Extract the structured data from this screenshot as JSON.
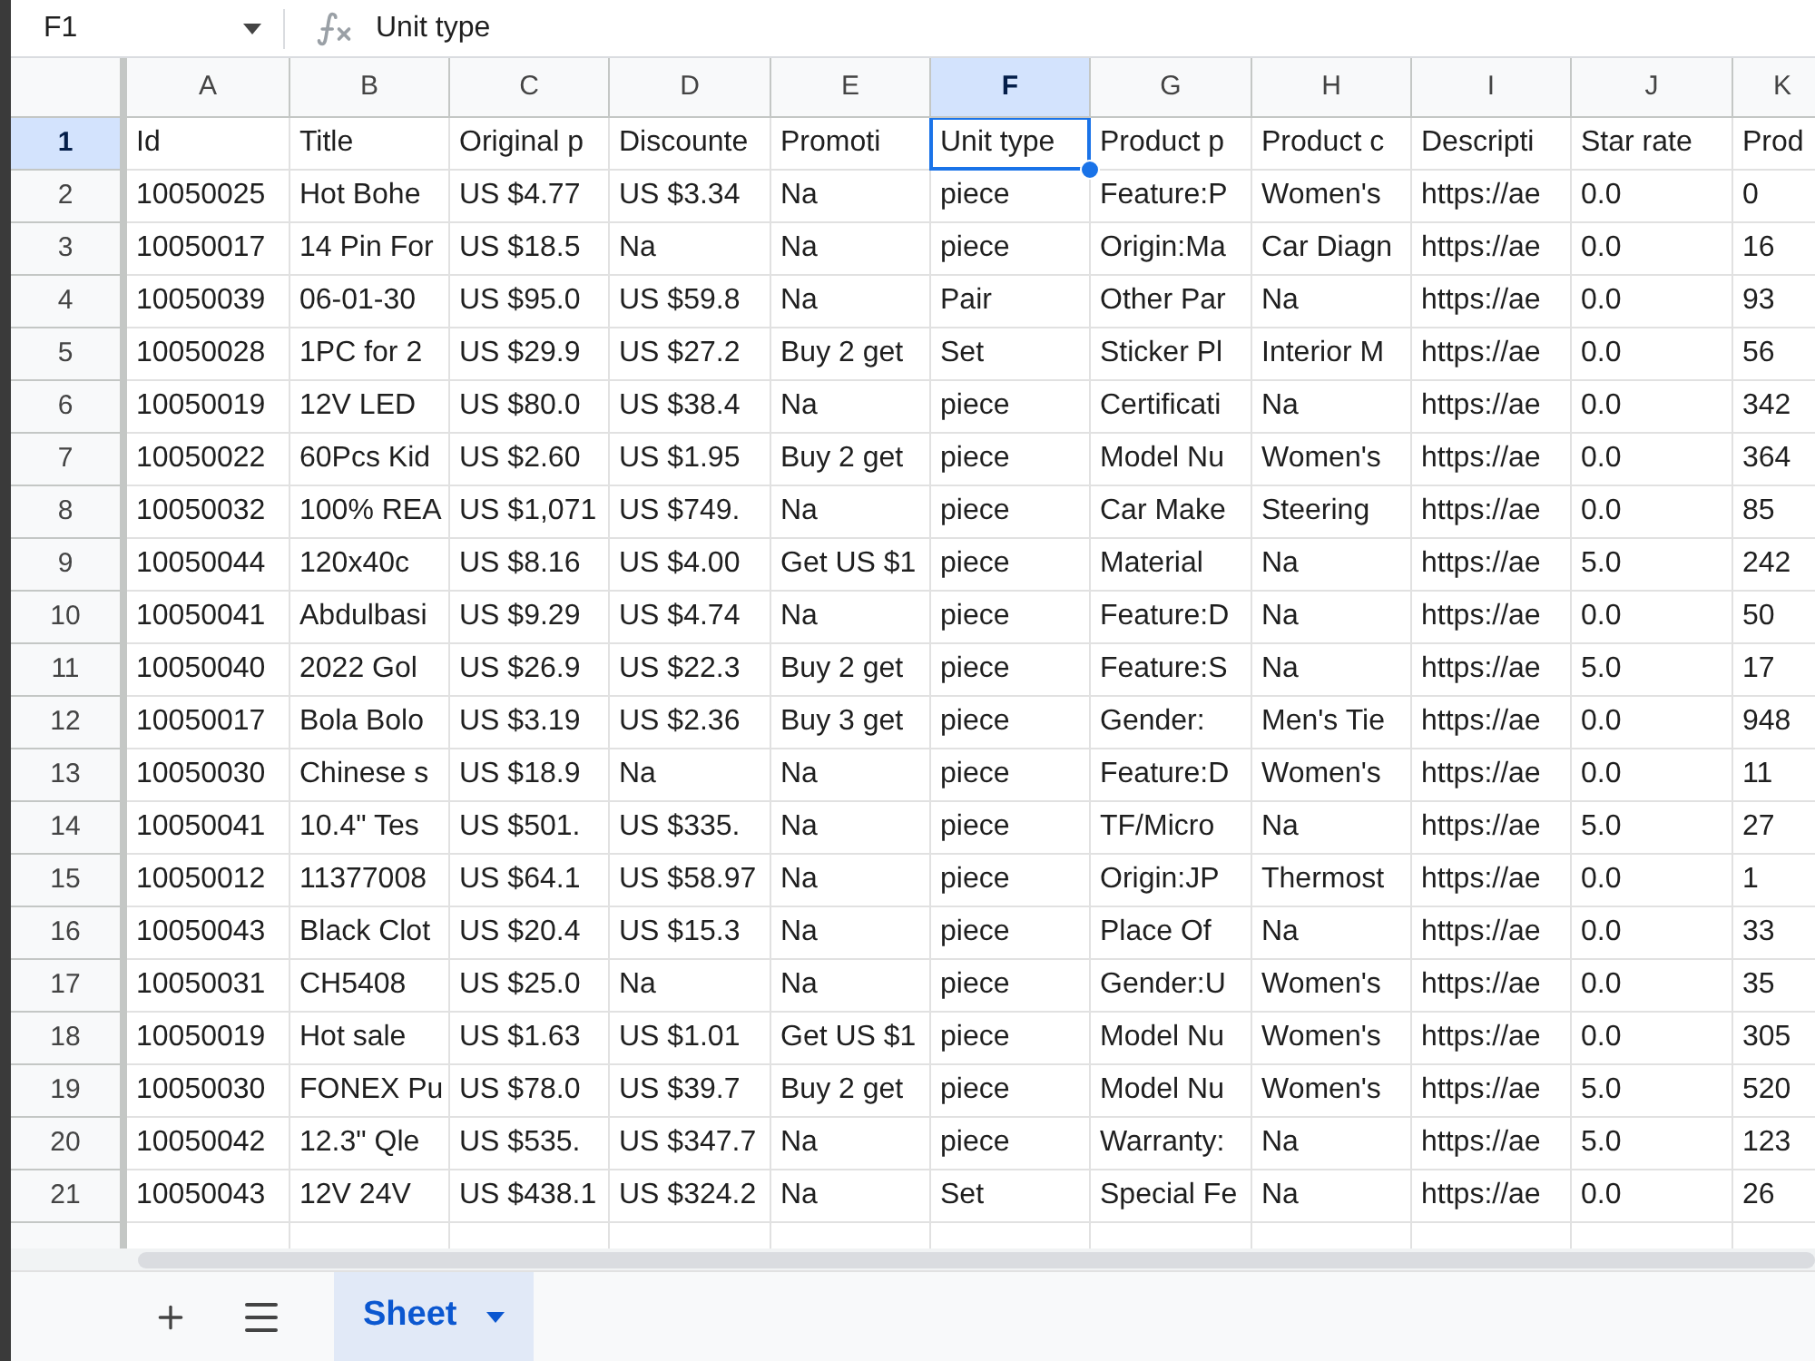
{
  "name_box": "F1",
  "formula_bar": {
    "value": "Unit type"
  },
  "columns": [
    {
      "label": "A",
      "selected": false
    },
    {
      "label": "B",
      "selected": false
    },
    {
      "label": "C",
      "selected": false
    },
    {
      "label": "D",
      "selected": false
    },
    {
      "label": "E",
      "selected": false
    },
    {
      "label": "F",
      "selected": true
    },
    {
      "label": "G",
      "selected": false
    },
    {
      "label": "H",
      "selected": false
    },
    {
      "label": "I",
      "selected": false
    },
    {
      "label": "J",
      "selected": false
    },
    {
      "label": "K",
      "selected": false
    }
  ],
  "rows": [
    {
      "number": "1",
      "selected": true,
      "cells": [
        "Id",
        "Title",
        "Original p",
        "Discounte",
        "Promoti",
        "Unit type",
        "Product p",
        "Product c",
        "Descripti",
        "Star rate",
        "Prod"
      ]
    },
    {
      "number": "2",
      "selected": false,
      "cells": [
        "10050025",
        "Hot Bohe",
        "US $4.77",
        "US $3.34",
        "Na",
        "piece",
        "Feature:P",
        "Women's",
        "https://ae",
        "0.0",
        "0"
      ]
    },
    {
      "number": "3",
      "selected": false,
      "cells": [
        "10050017",
        "14 Pin For",
        "US $18.5",
        "Na",
        "Na",
        "piece",
        "Origin:Ma",
        "Car Diagn",
        "https://ae",
        "0.0",
        "16"
      ]
    },
    {
      "number": "4",
      "selected": false,
      "cells": [
        "10050039",
        "06-01-30",
        "US $95.0",
        "US $59.8",
        "Na",
        "Pair",
        "Other Par",
        "Na",
        "https://ae",
        "0.0",
        "93"
      ]
    },
    {
      "number": "5",
      "selected": false,
      "cells": [
        "10050028",
        "1PC for 2",
        "US $29.9",
        "US $27.2",
        "Buy 2 get",
        "Set",
        "Sticker Pl",
        "Interior M",
        "https://ae",
        "0.0",
        "56"
      ]
    },
    {
      "number": "6",
      "selected": false,
      "cells": [
        "10050019",
        "12V LED",
        "US $80.0",
        "US $38.4",
        "Na",
        "piece",
        "Certificati",
        "Na",
        "https://ae",
        "0.0",
        "342"
      ]
    },
    {
      "number": "7",
      "selected": false,
      "cells": [
        "10050022",
        "60Pcs Kid",
        "US $2.60",
        "US $1.95",
        "Buy 2 get",
        "piece",
        "Model Nu",
        "Women's",
        "https://ae",
        "0.0",
        "364"
      ]
    },
    {
      "number": "8",
      "selected": false,
      "cells": [
        "10050032",
        "100% REA",
        "US $1,071",
        "US $749.",
        "Na",
        "piece",
        "Car Make",
        "Steering",
        "https://ae",
        "0.0",
        "85"
      ]
    },
    {
      "number": "9",
      "selected": false,
      "cells": [
        "10050044",
        "120x40c",
        "US $8.16",
        "US $4.00",
        "Get US $1",
        "piece",
        "Material",
        "Na",
        "https://ae",
        "5.0",
        "242"
      ]
    },
    {
      "number": "10",
      "selected": false,
      "cells": [
        "10050041",
        "Abdulbasi",
        "US $9.29",
        "US $4.74",
        "Na",
        "piece",
        "Feature:D",
        "Na",
        "https://ae",
        "0.0",
        "50"
      ]
    },
    {
      "number": "11",
      "selected": false,
      "cells": [
        "10050040",
        "2022 Gol",
        "US $26.9",
        "US $22.3",
        "Buy 2 get",
        "piece",
        "Feature:S",
        "Na",
        "https://ae",
        "5.0",
        "17"
      ]
    },
    {
      "number": "12",
      "selected": false,
      "cells": [
        "10050017",
        "Bola Bolo",
        "US $3.19",
        "US $2.36",
        "Buy 3 get",
        "piece",
        "Gender:",
        "Men's Tie",
        "https://ae",
        "0.0",
        "948"
      ]
    },
    {
      "number": "13",
      "selected": false,
      "cells": [
        "10050030",
        "Chinese s",
        "US $18.9",
        "Na",
        "Na",
        "piece",
        "Feature:D",
        "Women's",
        "https://ae",
        "0.0",
        "11"
      ]
    },
    {
      "number": "14",
      "selected": false,
      "cells": [
        "10050041",
        "10.4\" Tes",
        "US $501.",
        "US $335.",
        "Na",
        "piece",
        "TF/Micro",
        "Na",
        "https://ae",
        "5.0",
        "27"
      ]
    },
    {
      "number": "15",
      "selected": false,
      "cells": [
        "10050012",
        "11377008",
        "US $64.1",
        "US $58.97",
        "Na",
        "piece",
        "Origin:JP",
        "Thermost",
        "https://ae",
        "0.0",
        "1"
      ]
    },
    {
      "number": "16",
      "selected": false,
      "cells": [
        "10050043",
        "Black Clot",
        "US $20.4",
        "US $15.3",
        "Na",
        "piece",
        "Place Of",
        "Na",
        "https://ae",
        "0.0",
        "33"
      ]
    },
    {
      "number": "17",
      "selected": false,
      "cells": [
        "10050031",
        "CH5408",
        "US $25.0",
        "Na",
        "Na",
        "piece",
        "Gender:U",
        "Women's",
        "https://ae",
        "0.0",
        "35"
      ]
    },
    {
      "number": "18",
      "selected": false,
      "cells": [
        "10050019",
        "Hot sale",
        "US $1.63",
        "US $1.01",
        "Get US $1",
        "piece",
        "Model Nu",
        "Women's",
        "https://ae",
        "0.0",
        "305"
      ]
    },
    {
      "number": "19",
      "selected": false,
      "cells": [
        "10050030",
        "FONEX Pu",
        "US $78.0",
        "US $39.7",
        "Buy 2 get",
        "piece",
        "Model Nu",
        "Women's",
        "https://ae",
        "5.0",
        "520"
      ]
    },
    {
      "number": "20",
      "selected": false,
      "cells": [
        "10050042",
        "12.3\" Qle",
        "US $535.",
        "US $347.7",
        "Na",
        "piece",
        "Warranty:",
        "Na",
        "https://ae",
        "5.0",
        "123"
      ]
    },
    {
      "number": "21",
      "selected": false,
      "cells": [
        "10050043",
        "12V 24V",
        "US $438.1",
        "US $324.2",
        "Na",
        "Set",
        "Special Fe",
        "Na",
        "https://ae",
        "0.0",
        "26"
      ]
    }
  ],
  "sheet_tabs": [
    {
      "label": "Sheet",
      "selected": true
    }
  ]
}
